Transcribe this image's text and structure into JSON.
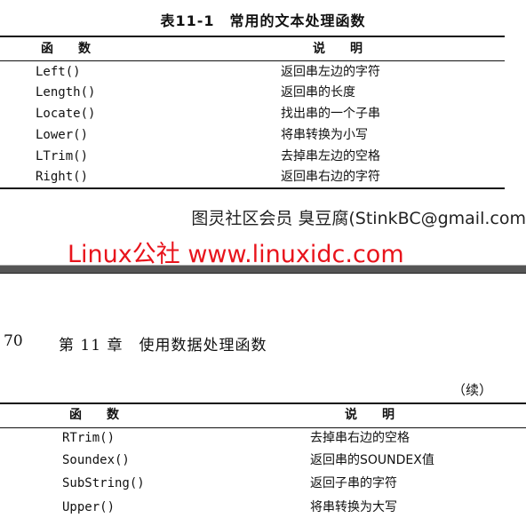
{
  "table1": {
    "title": "表11-1　常用的文本处理函数",
    "header": {
      "func": "函　　数",
      "desc": "说　　明"
    },
    "rows": [
      {
        "func": "Left()",
        "desc": "返回串左边的字符"
      },
      {
        "func": "Length()",
        "desc": "返回串的长度"
      },
      {
        "func": "Locate()",
        "desc": "找出串的一个子串"
      },
      {
        "func": "Lower()",
        "desc": "将串转换为小写"
      },
      {
        "func": "LTrim()",
        "desc": "去掉串左边的空格"
      },
      {
        "func": "Right()",
        "desc": "返回串右边的字符"
      }
    ]
  },
  "watermark": {
    "line1": "图灵社区会员 臭豆腐(StinkBC@gmail.com",
    "line2": "Linux公社 www.linuxidc.com",
    "line2_color": "#e8141c"
  },
  "page": {
    "number": "70",
    "chapter": "第 11 章　使用数据处理函数",
    "continued": "（续）"
  },
  "table2": {
    "header": {
      "func": "函　　数",
      "desc": "说　　明"
    },
    "rows": [
      {
        "func": "RTrim()",
        "desc": "去掉串右边的空格"
      },
      {
        "func": "Soundex()",
        "desc": "返回串的SOUNDEX值"
      },
      {
        "func": "SubString()",
        "desc": "返回子串的字符"
      },
      {
        "func": "Upper()",
        "desc": "将串转换为大写"
      }
    ]
  }
}
